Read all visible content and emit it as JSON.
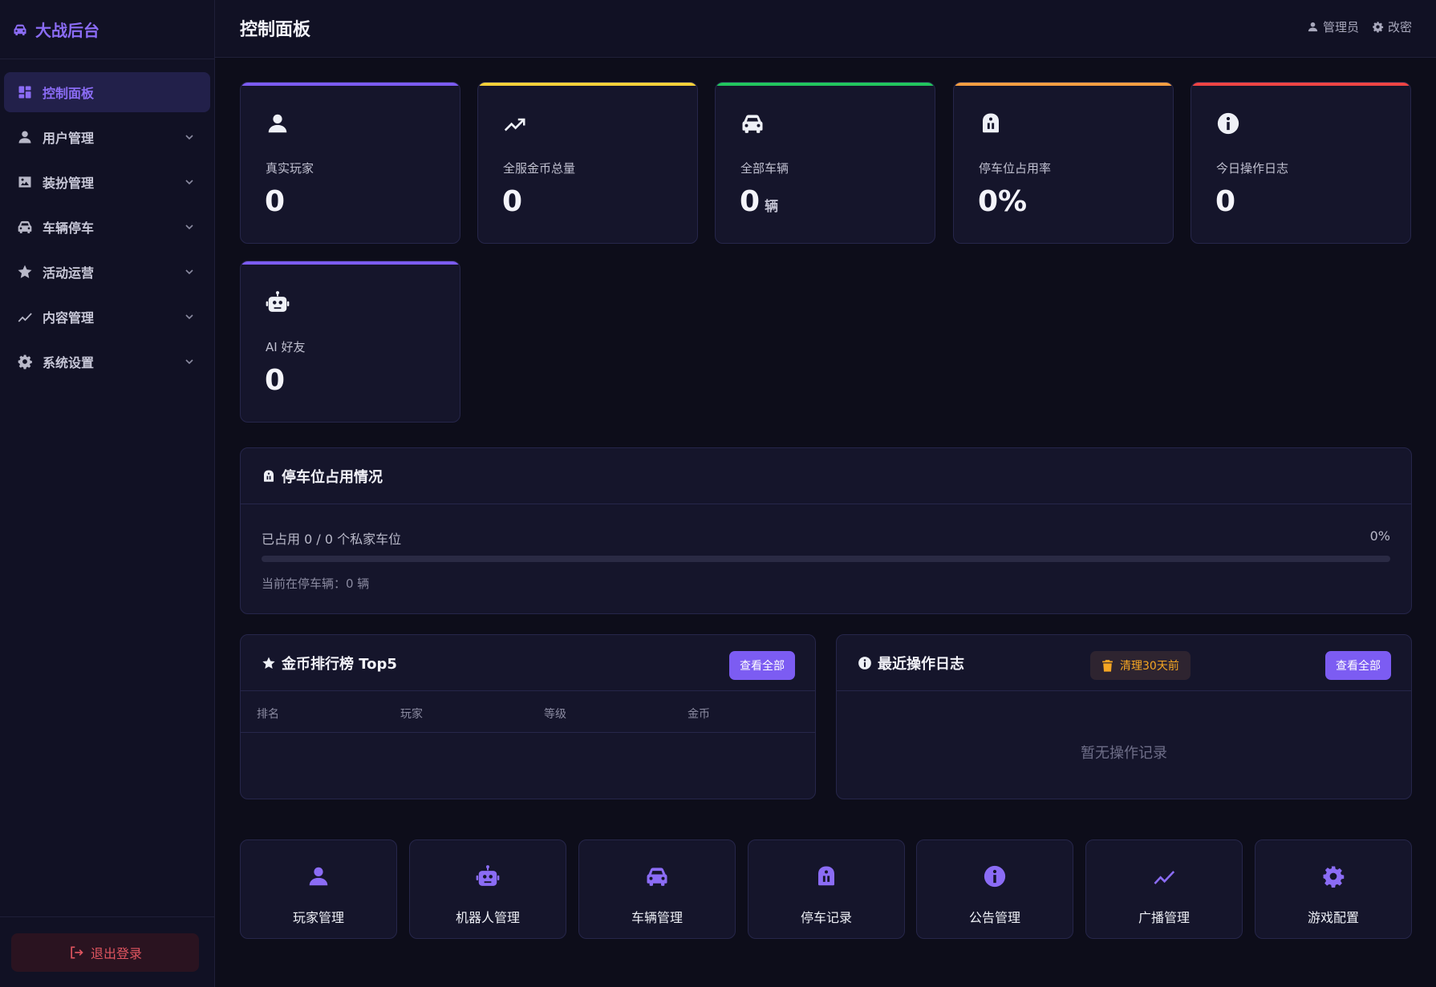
{
  "brand": {
    "name": "大战后台",
    "icon": "car-icon",
    "color": "#8b6cf5"
  },
  "sidebar": {
    "items": [
      {
        "label": "控制面板",
        "icon": "dashboard-icon",
        "active": true
      },
      {
        "label": "用户管理",
        "icon": "user-icon"
      },
      {
        "label": "装扮管理",
        "icon": "image-icon"
      },
      {
        "label": "车辆停车",
        "icon": "car-icon"
      },
      {
        "label": "活动运营",
        "icon": "star-icon"
      },
      {
        "label": "内容管理",
        "icon": "chart-line-icon"
      },
      {
        "label": "系统设置",
        "icon": "gear-icon"
      }
    ],
    "logout_label": "退出登录"
  },
  "header": {
    "title": "控制面板",
    "admin_label": "管理员",
    "password_label": "改密"
  },
  "stats": [
    {
      "label": "真实玩家",
      "value": "0",
      "unit": "",
      "accent": "#7c5cf2",
      "icon": "user-icon"
    },
    {
      "label": "全服金币总量",
      "value": "0",
      "unit": "",
      "accent": "#f5d03a",
      "icon": "trend-up-icon"
    },
    {
      "label": "全部车辆",
      "value": "0",
      "unit": "辆",
      "accent": "#22c55e",
      "icon": "car-icon"
    },
    {
      "label": "停车位占用率",
      "value": "0%",
      "unit": "",
      "accent": "#f59e42",
      "icon": "parking-icon"
    },
    {
      "label": "今日操作日志",
      "value": "0",
      "unit": "",
      "accent": "#ef4444",
      "icon": "info-icon"
    },
    {
      "label": "AI 好友",
      "value": "0",
      "unit": "",
      "accent": "#7c5cf2",
      "icon": "robot-icon"
    }
  ],
  "parking": {
    "title": "停车位占用情况",
    "occupied_text": "已占用 0 / 0 个私家车位",
    "percent_text": "0%",
    "fill_fraction": 0,
    "current_text": "当前在停车辆：0 辆"
  },
  "leaderboard": {
    "title": "金币排行榜 Top5",
    "view_all": "查看全部",
    "columns": [
      "排名",
      "玩家",
      "等级",
      "金币"
    ],
    "rows": []
  },
  "logs": {
    "title": "最近操作日志",
    "clean_label": "清理30天前",
    "view_all": "查看全部",
    "empty": "暂无操作记录"
  },
  "quick_links": [
    {
      "label": "玩家管理",
      "icon": "user-icon"
    },
    {
      "label": "机器人管理",
      "icon": "robot-icon"
    },
    {
      "label": "车辆管理",
      "icon": "car-icon"
    },
    {
      "label": "停车记录",
      "icon": "parking-icon"
    },
    {
      "label": "公告管理",
      "icon": "info-icon"
    },
    {
      "label": "广播管理",
      "icon": "chart-line-icon"
    },
    {
      "label": "游戏配置",
      "icon": "gear-icon"
    }
  ],
  "colors": {
    "background": "#0d0d1a",
    "panel": "#15152b",
    "accent": "#7c5cf2",
    "warning": "#f5a623",
    "danger": "#e05560"
  }
}
